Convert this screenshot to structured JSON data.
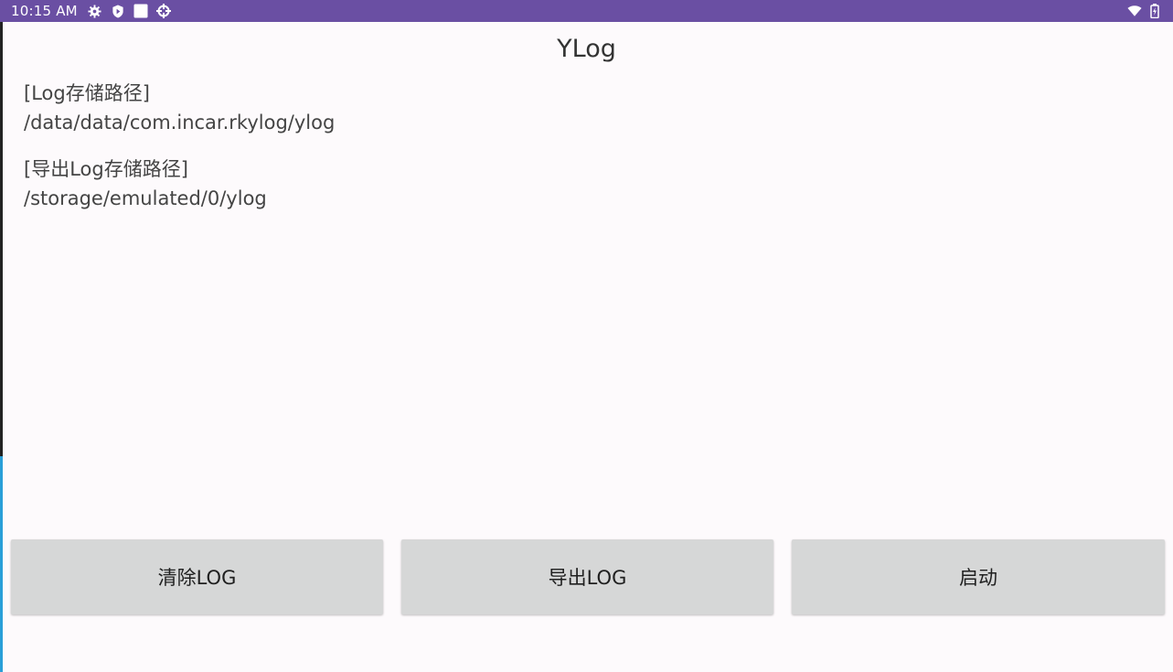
{
  "status_bar": {
    "time": "10:15 AM",
    "icons": [
      "gear-icon",
      "shield-icon",
      "square-icon",
      "crosshair-icon",
      "wifi-icon",
      "battery-icon"
    ],
    "color": "#6a4fa3"
  },
  "app": {
    "title": "YLog"
  },
  "paths": {
    "log_label": "[Log存储路径]",
    "log_value": "/data/data/com.incar.rkylog/ylog",
    "export_label": "[导出Log存储路径]",
    "export_value": "/storage/emulated/0/ylog"
  },
  "buttons": {
    "clear": "清除LOG",
    "export": "导出LOG",
    "start": "启动"
  }
}
